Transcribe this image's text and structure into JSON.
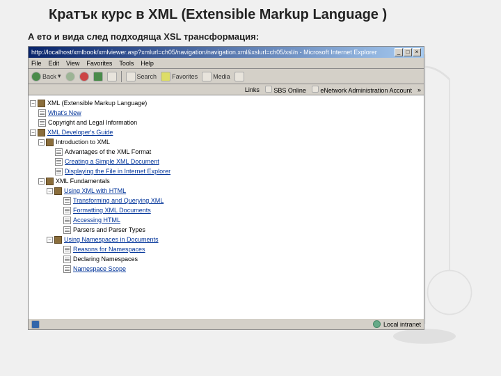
{
  "slide": {
    "title": "Кратък курс в XML (Extensible Markup Language )",
    "subtitle": "А ето и вида след подходяща XSL трансформация:"
  },
  "browser": {
    "titlebar": "http://localhost/xmlbook/xmlviewer.asp?xmlurl=ch05/navigation/navigation.xml&xslurl=ch05/xsl/n - Microsoft Internet Explorer",
    "menu": [
      "File",
      "Edit",
      "View",
      "Favorites",
      "Tools",
      "Help"
    ],
    "toolbar": {
      "back": "Back",
      "search": "Search",
      "favorites": "Favorites",
      "media": "Media"
    },
    "links": {
      "label": "Links",
      "item1": "SBS Online",
      "item2": "eNetwork Administration Account"
    },
    "statusbar": {
      "zone": "Local intranet"
    }
  },
  "tree": {
    "root": "XML (Extensible Markup Language)",
    "n1": "What's New",
    "n2": "Copyright and Legal Information",
    "n3": "XML Developer's Guide",
    "n3_1": "Introduction to XML",
    "n3_1_1": "Advantages of the XML Format",
    "n3_1_2": "Creating a Simple XML Document",
    "n3_1_3": "Displaying the File in Internet Explorer",
    "n3_2": "XML Fundamentals",
    "n3_2_1": "Using XML with HTML",
    "n3_2_1_1": "Transforming and Querying XML",
    "n3_2_1_2": "Formatting XML Documents",
    "n3_2_1_3": "Accessing HTML",
    "n3_2_1_4": "Parsers and Parser Types",
    "n3_2_2": "Using Namespaces in Documents",
    "n3_2_2_1": "Reasons for Namespaces",
    "n3_2_2_2": "Declaring Namespaces",
    "n3_2_2_3": "Namespace Scope"
  }
}
